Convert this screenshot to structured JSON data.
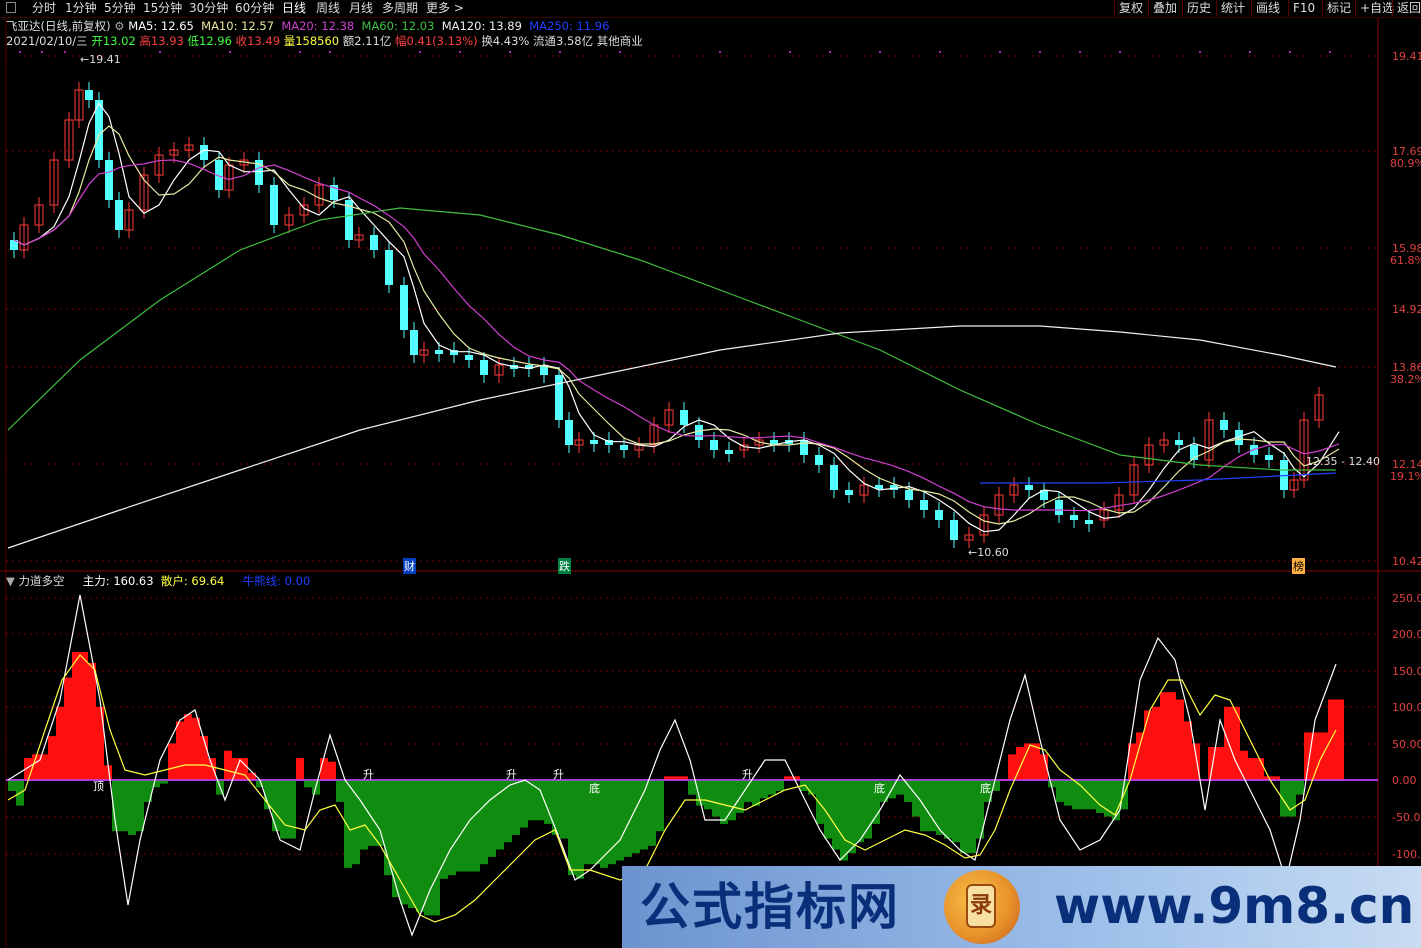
{
  "toolbar": {
    "left": [
      "分时",
      "1分钟",
      "5分钟",
      "15分钟",
      "30分钟",
      "60分钟",
      "日线",
      "周线",
      "月线",
      "多周期",
      "更多 >"
    ],
    "active_index": 6,
    "right": [
      "复权",
      "叠加",
      "历史",
      "统计",
      "画线",
      "F10",
      "标记",
      "+自选",
      "返回"
    ]
  },
  "header": {
    "title": "飞亚达(日线,前复权)",
    "ma5": "MA5: 12.65",
    "ma10": "MA10: 12.57",
    "ma20": "MA20: 12.38",
    "ma60": "MA60: 12.03",
    "ma120": "MA120: 13.89",
    "ma250": "MA250: 11.96"
  },
  "quote": {
    "date": "2021/02/10/三",
    "open": "开13.02",
    "high": "高13.93",
    "low": "低12.96",
    "close": "收13.49",
    "volume": "量158560",
    "amount": "额2.11亿",
    "change": "幅0.41(3.13%)",
    "turnover": "换4.43%",
    "float": "流通3.58亿",
    "sector": "其他商业"
  },
  "price_axis": [
    "19.41",
    "17.69",
    "15.98",
    "14.92",
    "13.86",
    "12.14",
    "10.42"
  ],
  "pct_axis": [
    "80.9%",
    "61.8%",
    "38.2%",
    "19.1%"
  ],
  "annotations": {
    "high_label": "19.41",
    "low_label": "10.60",
    "range_label": "12.35 - 12.40",
    "cai": "财",
    "die": "跌",
    "bang": "榜"
  },
  "indicator": {
    "name": "力道多空",
    "zhuli": "主力: 160.63",
    "sanhu": "散户: 69.64",
    "niuxiong": "牛熊线: 0.00",
    "axis": [
      "250.00",
      "200.00",
      "150.00",
      "100.00",
      "50.00",
      "0.00",
      "-50.00",
      "-100.00"
    ],
    "signals": {
      "ding": "顶",
      "sheng": "升",
      "di": "底"
    }
  },
  "watermark": {
    "left": "公式指标网",
    "right": "www.9m8.cn",
    "logo_glyph": "录"
  },
  "colors": {
    "up": "#ff3b3b",
    "down": "#54ffff",
    "ma5": "#ffffff",
    "ma10": "#e8e8a0",
    "ma20": "#d040d0",
    "ma60": "#40c040",
    "ma120": "#f0f0f0",
    "ma250": "#2040ff",
    "hist_up": "#ff1010",
    "hist_down": "#108c10",
    "zhuli_line": "#ffffff",
    "sanhu_line": "#ffff40"
  }
}
